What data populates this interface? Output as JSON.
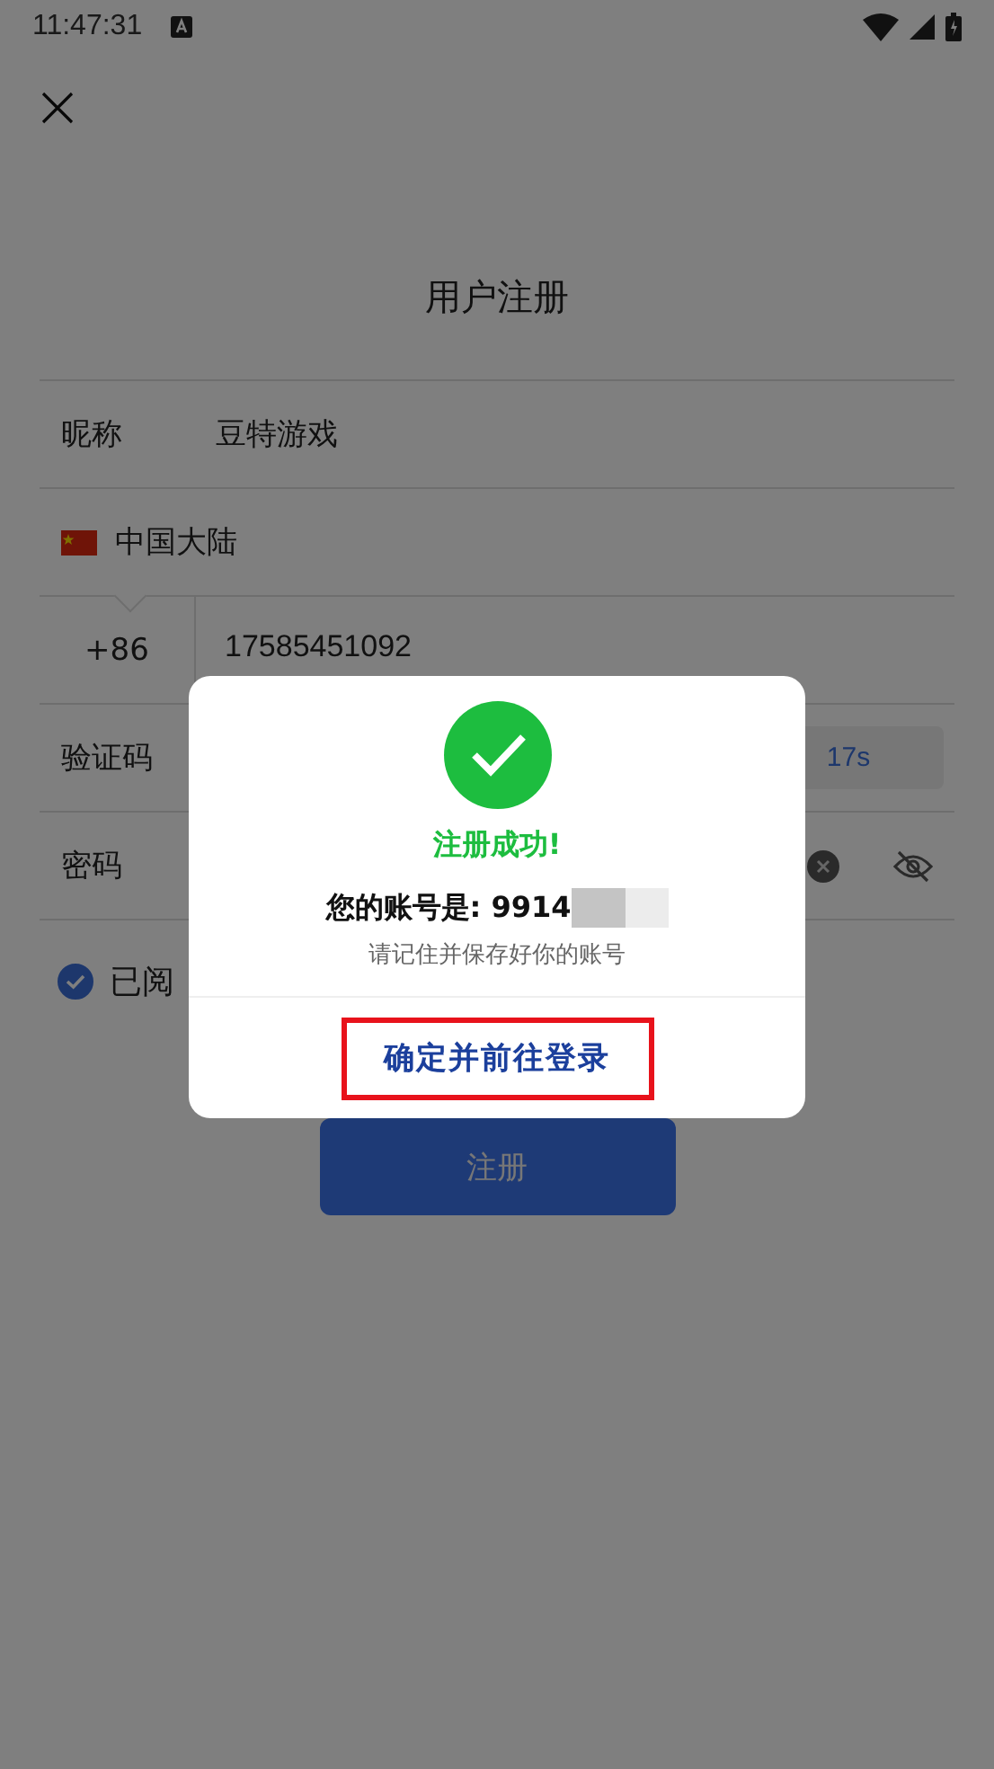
{
  "status_bar": {
    "time": "11:47:31"
  },
  "page": {
    "title": "用户注册"
  },
  "form": [
    {
      "kind": "text",
      "label": "昵称",
      "value": "豆特游戏"
    },
    {
      "kind": "region",
      "value": "中国大陆"
    },
    {
      "kind": "phone",
      "prefix": "+86",
      "value": "17585451092"
    },
    {
      "kind": "code",
      "label": "验证码",
      "countdown": "17s"
    },
    {
      "kind": "password",
      "label": "密码"
    }
  ],
  "agreement": {
    "checked": true,
    "label": "已阅"
  },
  "register_button": {
    "label": "注册"
  },
  "dialog": {
    "title": "注册成功!",
    "account_label": "您的账号是: 9914",
    "note": "请记住并保存好你的账号",
    "confirm": "确定并前往登录"
  }
}
